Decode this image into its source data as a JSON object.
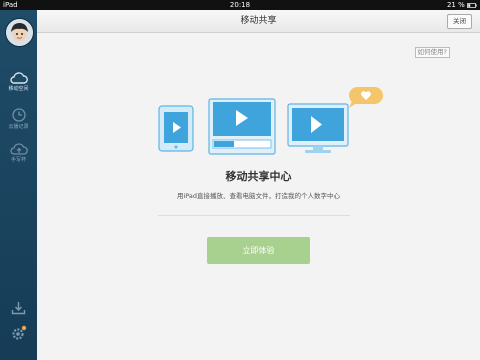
{
  "status_bar": {
    "carrier": "iPad",
    "time": "20:18",
    "battery": "21 %"
  },
  "sidebar": {
    "items": [
      {
        "label": "移动空间",
        "icon": "cloud-icon"
      },
      {
        "label": "云播记录",
        "icon": "clock-icon"
      },
      {
        "label": "手写杯",
        "icon": "cloud-upload-icon"
      }
    ],
    "bottom_icons": [
      "download-icon",
      "settings-icon"
    ]
  },
  "header": {
    "title": "移动共享",
    "close_label": "关闭"
  },
  "help_link": "如何使用?",
  "main": {
    "headline": "移动共享中心",
    "subline": "用iPad直接播放、查看电脑文件，打造我的个人数字中心",
    "cta_label": "立即体验"
  },
  "colors": {
    "sidebar": "#1f4c68",
    "accent": "#4aa9dc",
    "cta": "#a8d08e",
    "bubble": "#f4c56b"
  }
}
